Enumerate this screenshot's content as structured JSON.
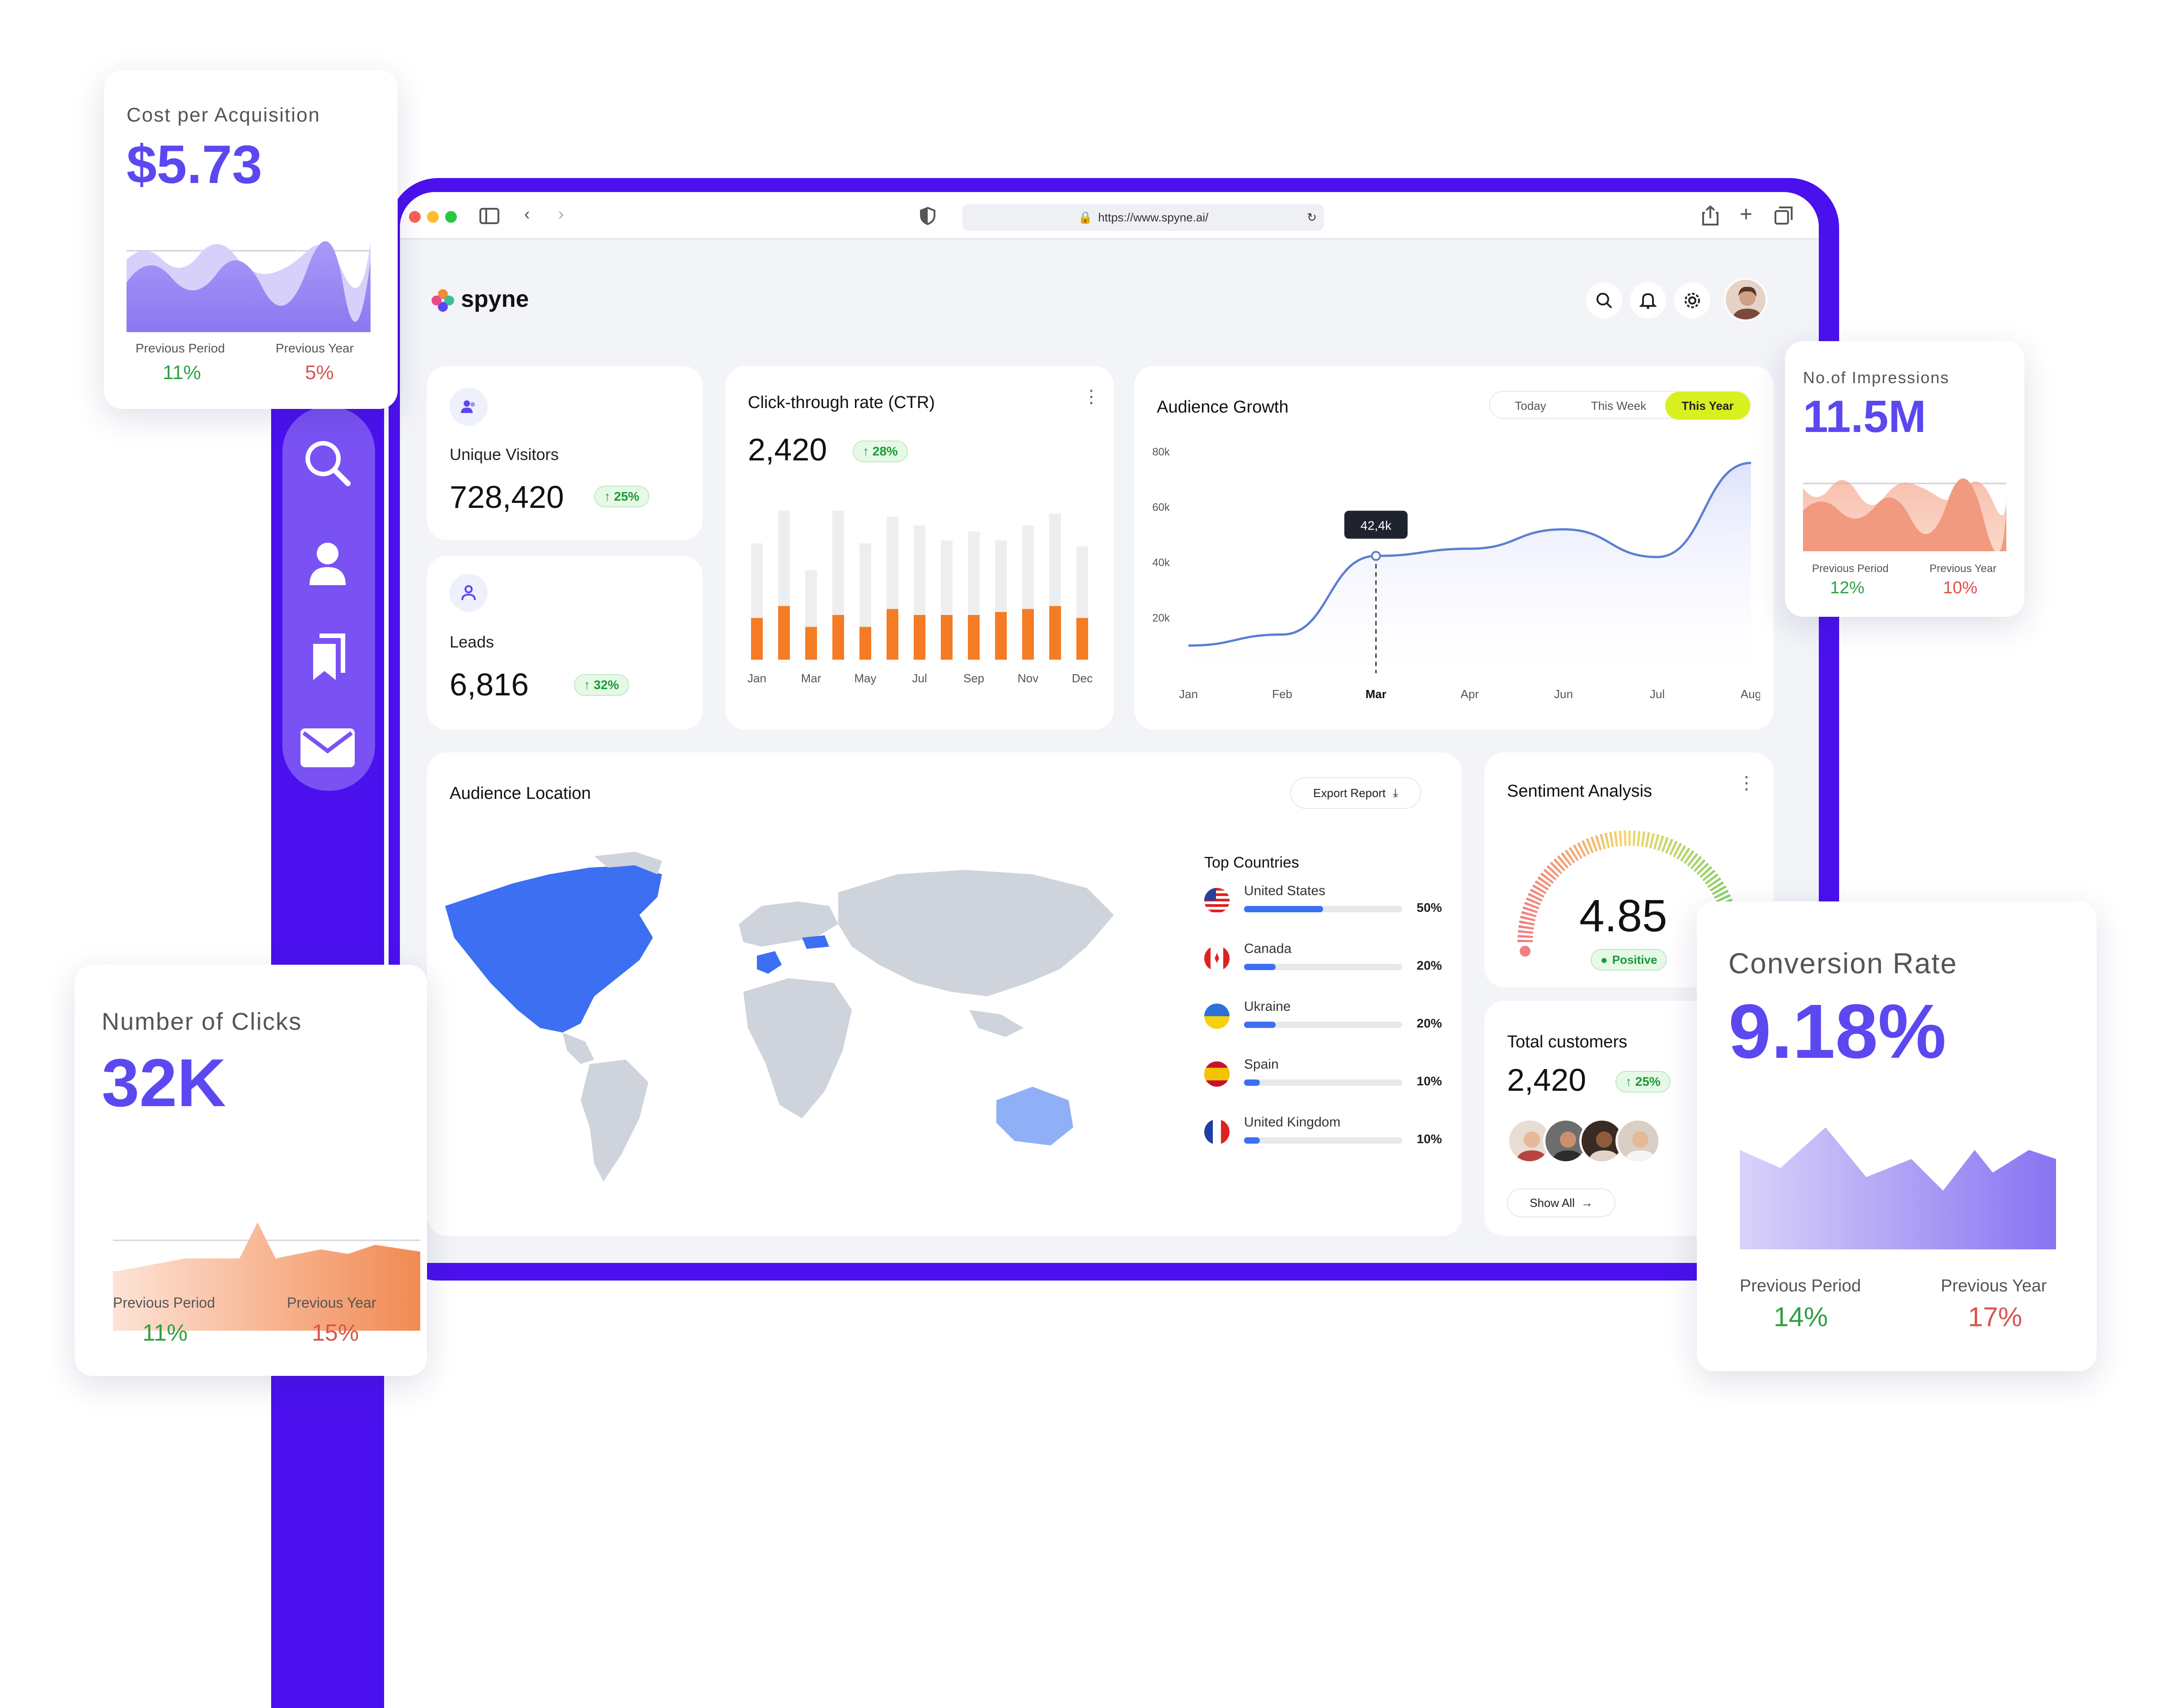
{
  "browser": {
    "url": "https://www.spyne.ai/"
  },
  "app": {
    "brand": "spyne"
  },
  "cards": {
    "unique_visitors": {
      "label": "Unique Visitors",
      "value": "728,420",
      "change": "↑ 25%"
    },
    "leads": {
      "label": "Leads",
      "value": "6,816",
      "change": "↑ 32%"
    },
    "ctr": {
      "title": "Click-through rate (CTR)",
      "value": "2,420",
      "change": "↑ 28%"
    },
    "audience_growth": {
      "title": "Audience Growth",
      "tabs": [
        "Today",
        "This Week",
        "This Year"
      ],
      "active_tab": "This Year",
      "tooltip": "42,4k"
    },
    "audience_location": {
      "title": "Audience Location",
      "export_label": "Export Report",
      "top_countries_title": "Top Countries",
      "countries": [
        {
          "name": "United States",
          "percent": "50%",
          "share": 0.5
        },
        {
          "name": "Canada",
          "percent": "20%",
          "share": 0.2
        },
        {
          "name": "Ukraine",
          "percent": "20%",
          "share": 0.2
        },
        {
          "name": "Spain",
          "percent": "10%",
          "share": 0.1
        },
        {
          "name": "United Kingdom",
          "percent": "10%",
          "share": 0.1
        }
      ]
    },
    "sentiment": {
      "title": "Sentiment Analysis",
      "score": "4.85",
      "status": "Positive"
    },
    "total_customers": {
      "title": "Total customers",
      "value": "2,420",
      "change": "↑ 25%",
      "show_all": "Show All"
    }
  },
  "floating": {
    "cpa": {
      "title": "Cost per Acquisition",
      "value": "$5.73",
      "prev_period_label": "Previous Period",
      "prev_period": "11%",
      "prev_year_label": "Previous Year",
      "prev_year": "5%"
    },
    "impressions": {
      "title": "No.of Impressions",
      "value": "11.5M",
      "prev_period_label": "Previous Period",
      "prev_period": "12%",
      "prev_year_label": "Previous Year",
      "prev_year": "10%"
    },
    "clicks": {
      "title": "Number of Clicks",
      "value": "32K",
      "prev_period_label": "Previous Period",
      "prev_period": "11%",
      "prev_year_label": "Previous Year",
      "prev_year": "15%"
    },
    "conversion": {
      "title": "Conversion Rate",
      "value": "9.18%",
      "prev_period_label": "Previous Period",
      "prev_period": "14%",
      "prev_year_label": "Previous Year",
      "prev_year": "17%"
    }
  },
  "colors": {
    "accent": "#4a11ee",
    "bar_orange": "#f57c24",
    "bar_gray": "#eeeeee",
    "map_blue": "#3d6ff2",
    "highlight_yellow": "#d8f01f"
  },
  "chart_data": [
    {
      "type": "bar",
      "title": "Click-through rate (CTR)",
      "categories": [
        "Jan",
        "",
        "Mar",
        "",
        "May",
        "",
        "Jul",
        "",
        "Sep",
        "",
        "Nov",
        "",
        "Dec"
      ],
      "x_tick_labels": [
        "Jan",
        "Mar",
        "May",
        "Jul",
        "Sep",
        "Nov",
        "Dec"
      ],
      "series": [
        {
          "values": [
            28,
            36,
            22,
            30,
            22,
            34,
            30,
            30,
            30,
            32,
            34,
            36,
            28
          ]
        },
        {
          "values": [
            78,
            100,
            60,
            100,
            78,
            96,
            90,
            80,
            86,
            80,
            90,
            98,
            76
          ]
        }
      ],
      "ylim": [
        0,
        100
      ]
    },
    {
      "type": "area",
      "title": "Audience Growth",
      "x": [
        "Jan",
        "Feb",
        "Mar",
        "Apr",
        "Jun",
        "Jul",
        "Aug"
      ],
      "values": [
        10,
        14,
        42.4,
        45,
        52,
        42,
        76
      ],
      "y_tick_labels": [
        "80k",
        "60k",
        "40k",
        "20k"
      ],
      "ylim": [
        0,
        80
      ],
      "highlight": {
        "x": "Mar",
        "label": "42,4k"
      }
    }
  ]
}
